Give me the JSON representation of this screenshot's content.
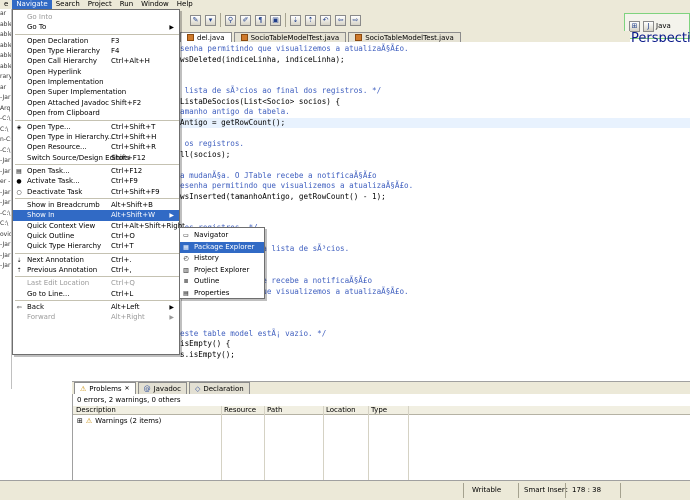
{
  "menubar": {
    "items": [
      "Navigate",
      "Search",
      "Project",
      "Run",
      "Window",
      "Help"
    ],
    "cut_left": "e"
  },
  "perspective": {
    "java_label": "Java",
    "title": "Perspecti"
  },
  "left_strip": [
    "ar",
    "able",
    "able",
    "able",
    "able",
    "able",
    "rary",
    "ar",
    "-Jar",
    "Arq",
    "-C:\\",
    "C:\\",
    "n-C:\\",
    "-C:\\",
    "-Jar",
    "-Jar",
    "er - C:\\",
    "-Jar",
    "-Jar",
    "-C:\\",
    "C:\\",
    "ovide",
    "-Jar",
    "-Jar",
    "-Jar"
  ],
  "editor_tabs": [
    {
      "label": "del.java",
      "active": true
    },
    {
      "label": "SocioTableModelTest.java",
      "active": false
    },
    {
      "label": "SocioTableModelTest.java",
      "active": false
    }
  ],
  "code_lines": [
    {
      "text": "senha permitindo que visualizemos a atualizaÃ§Ã£o.",
      "kind": "comment"
    },
    {
      "text": "wsDeleted(indiceLinha, indiceLinha);",
      "kind": "code"
    },
    {
      "text": "",
      "kind": "code"
    },
    {
      "text": "",
      "kind": "code"
    },
    {
      "text": " lista de sÃ³cios ao final dos registros. */",
      "kind": "comment"
    },
    {
      "text": "ListaDeSocios(List<Socio> socios) {",
      "kind": "code"
    },
    {
      "text": "amanho antigo da tabela.",
      "kind": "comment"
    },
    {
      "text": "Antigo = getRowCount();",
      "kind": "hl"
    },
    {
      "text": "",
      "kind": "code"
    },
    {
      "text": " os registros.",
      "kind": "comment"
    },
    {
      "text": "ll(socios);",
      "kind": "code"
    },
    {
      "text": "",
      "kind": "code"
    },
    {
      "text": "a mudanÃ§a. O JTable recebe a notificaÃ§Ã£o",
      "kind": "comment"
    },
    {
      "text": "esenha permitindo que visualizemos a atualizaÃ§Ã£o.",
      "kind": "comment"
    },
    {
      "text": "wsInserted(tamanhoAntigo, getRowCount() - 1);",
      "kind": "code"
    },
    {
      "text": "",
      "kind": "code"
    },
    {
      "text": "",
      "kind": "code"
    },
    {
      "text": " os registros. */",
      "kind": "comment"
    },
    {
      "text": "mar() {",
      "kind": "code"
    },
    {
      "text": "                 da lista de sÃ³cios.",
      "kind": "comment"
    },
    {
      "text": "",
      "kind": "code"
    },
    {
      "text": "",
      "kind": "code"
    },
    {
      "text": "                 le recebe a notificaÃ§Ã£o",
      "kind": "comment"
    },
    {
      "text": "                 que visualizemos a atualizaÃ§Ã£o.",
      "kind": "comment"
    },
    {
      "text": "",
      "kind": "code"
    },
    {
      "text": "",
      "kind": "code"
    },
    {
      "text": "",
      "kind": "code"
    },
    {
      "text": "este table model estÃ¡ vazio. */",
      "kind": "comment"
    },
    {
      "text": "isEmpty() {",
      "kind": "code"
    },
    {
      "text": "s.isEmpty();",
      "kind": "code"
    }
  ],
  "navigate_menu": [
    {
      "label": "Go Into",
      "acc": "",
      "disabled": true
    },
    {
      "label": "Go To",
      "acc": "",
      "submenu": true
    },
    {
      "sep": true
    },
    {
      "label": "Open Declaration",
      "acc": "F3"
    },
    {
      "label": "Open Type Hierarchy",
      "acc": "F4"
    },
    {
      "label": "Open Call Hierarchy",
      "acc": "Ctrl+Alt+H"
    },
    {
      "label": "Open Hyperlink",
      "acc": ""
    },
    {
      "label": "Open Implementation",
      "acc": ""
    },
    {
      "label": "Open Super Implementation",
      "acc": ""
    },
    {
      "label": "Open Attached Javadoc",
      "acc": "Shift+F2"
    },
    {
      "label": "Open from Clipboard",
      "acc": ""
    },
    {
      "sep": true
    },
    {
      "label": "Open Type...",
      "acc": "Ctrl+Shift+T",
      "icon": "open-type-icon"
    },
    {
      "label": "Open Type in Hierarchy...",
      "acc": "Ctrl+Shift+H"
    },
    {
      "label": "Open Resource...",
      "acc": "Ctrl+Shift+R"
    },
    {
      "label": "Switch Source/Design Editors",
      "acc": "Shift+F12"
    },
    {
      "sep": true
    },
    {
      "label": "Open Task...",
      "acc": "Ctrl+F12",
      "icon": "open-task-icon"
    },
    {
      "label": "Activate Task...",
      "acc": "Ctrl+F9",
      "icon": "activate-task-icon"
    },
    {
      "label": "Deactivate Task",
      "acc": "Ctrl+Shift+F9",
      "icon": "deactivate-task-icon"
    },
    {
      "sep": true
    },
    {
      "label": "Show in Breadcrumb",
      "acc": "Alt+Shift+B"
    },
    {
      "label": "Show In",
      "acc": "Alt+Shift+W",
      "submenu": true,
      "selected": true
    },
    {
      "label": "Quick Context View",
      "acc": "Ctrl+Alt+Shift+Right"
    },
    {
      "label": "Quick Outline",
      "acc": "Ctrl+O"
    },
    {
      "label": "Quick Type Hierarchy",
      "acc": "Ctrl+T"
    },
    {
      "sep": true
    },
    {
      "label": "Next Annotation",
      "acc": "Ctrl+.",
      "icon": "next-annotation-icon"
    },
    {
      "label": "Previous Annotation",
      "acc": "Ctrl+,",
      "icon": "previous-annotation-icon"
    },
    {
      "sep": true
    },
    {
      "label": "Last Edit Location",
      "acc": "Ctrl+Q",
      "disabled": true
    },
    {
      "label": "Go to Line...",
      "acc": "Ctrl+L"
    },
    {
      "sep": true
    },
    {
      "label": "Back",
      "acc": "Alt+Left",
      "submenu": true,
      "icon": "back-icon"
    },
    {
      "label": "Forward",
      "acc": "Alt+Right",
      "submenu": true,
      "disabled": true
    }
  ],
  "show_in_menu": [
    {
      "label": "Navigator",
      "icon": "navigator-icon"
    },
    {
      "label": "Package Explorer",
      "icon": "package-explorer-icon",
      "selected": true
    },
    {
      "label": "History",
      "icon": "history-icon"
    },
    {
      "label": "Project Explorer",
      "icon": "project-explorer-icon"
    },
    {
      "label": "Outline",
      "icon": "outline-icon"
    },
    {
      "label": "Properties",
      "icon": "properties-icon"
    }
  ],
  "bottom_tabs": [
    {
      "label": "Problems",
      "active": true,
      "icon": "problems-icon"
    },
    {
      "label": "Javadoc",
      "active": false,
      "icon": "javadoc-icon"
    },
    {
      "label": "Declaration",
      "active": false,
      "icon": "declaration-icon"
    }
  ],
  "problems": {
    "summary": "0 errors, 2 warnings, 0 others",
    "columns": [
      "Description",
      "Resource",
      "Path",
      "Location",
      "Type"
    ],
    "rows": [
      {
        "label": "Warnings (2 items)"
      }
    ]
  },
  "status": {
    "mode": "Writable",
    "insert": "Smart Insert",
    "position": "178 : 38"
  }
}
